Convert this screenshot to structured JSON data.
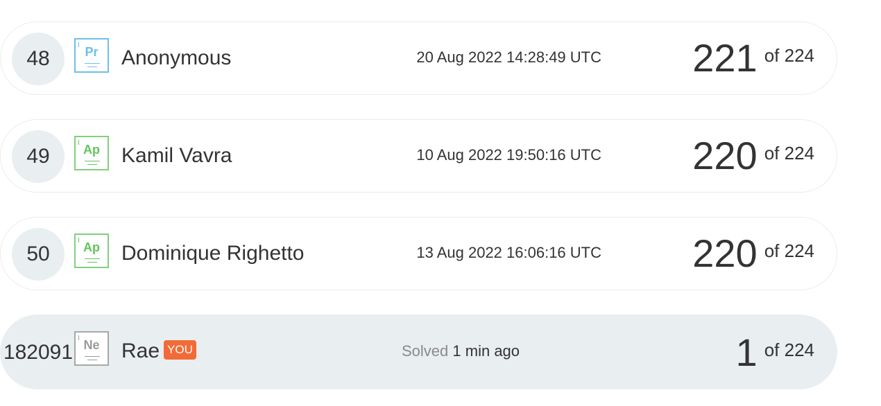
{
  "rows": [
    {
      "rank": "48",
      "badge": {
        "symbol": "Pr",
        "icon": "praseodymium-element-icon",
        "color": "#6cc0e8"
      },
      "name": "Anonymous",
      "date": "20 Aug 2022 14:28:49 UTC",
      "score": "221",
      "total": "of 224"
    },
    {
      "rank": "49",
      "badge": {
        "symbol": "Ap",
        "icon": "ap-element-icon",
        "color": "#62c45c"
      },
      "name": "Kamil Vavra",
      "date": "10 Aug 2022 19:50:16 UTC",
      "score": "220",
      "total": "of 224"
    },
    {
      "rank": "50",
      "badge": {
        "symbol": "Ap",
        "icon": "ap-element-icon",
        "color": "#62c45c"
      },
      "name": "Dominique Righetto",
      "date": "13 Aug 2022 16:06:16 UTC",
      "score": "220",
      "total": "of 224"
    }
  ],
  "current_user": {
    "rank": "182091",
    "badge": {
      "symbol": "Ne",
      "icon": "neon-element-icon",
      "color": "#9a9a9a"
    },
    "name": "Rae",
    "you_label": "YOU",
    "solved_label": "Solved",
    "solved_time": "1 min ago",
    "score": "1",
    "total": "of 224"
  },
  "colors": {
    "you_tag": "#f26b37",
    "highlight_row": "#e9eef0"
  }
}
